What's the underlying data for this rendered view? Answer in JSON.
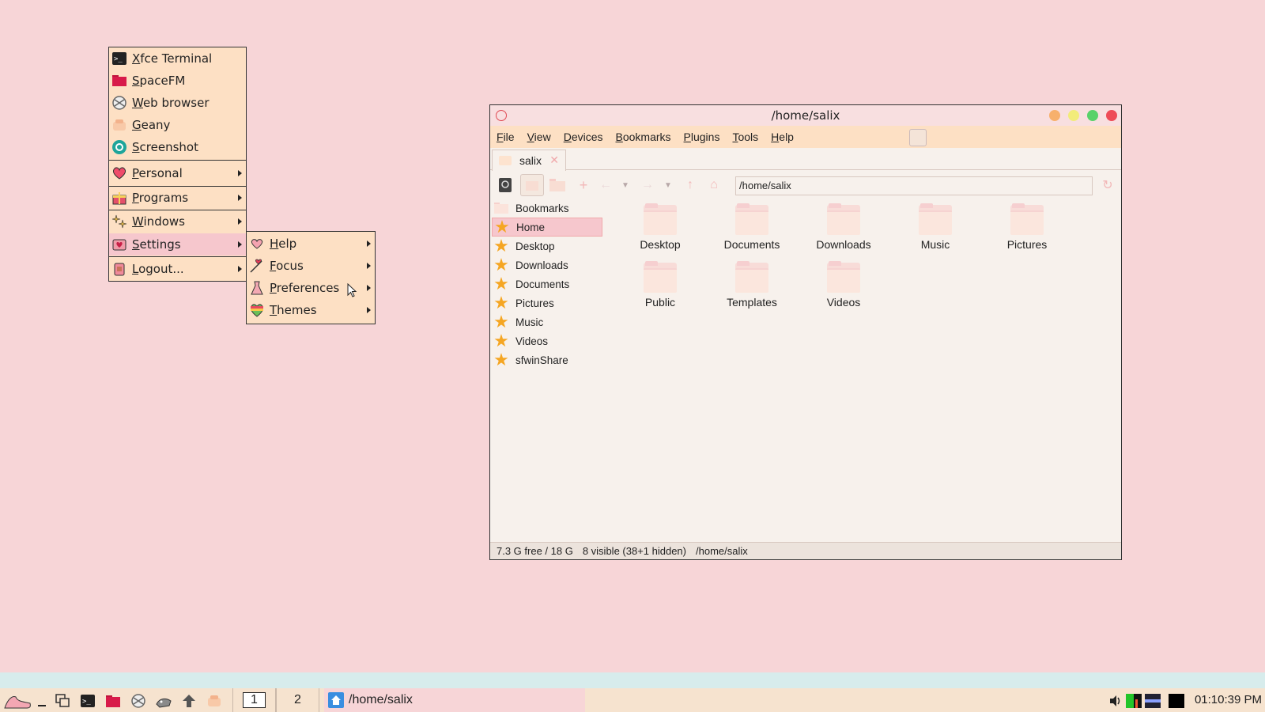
{
  "root_menu": {
    "items": [
      {
        "label": "Xfce Terminal",
        "icon": "terminal-icon"
      },
      {
        "label": "SpaceFM",
        "icon": "folder-red-icon"
      },
      {
        "label": "Web browser",
        "icon": "web-browser-icon"
      },
      {
        "label": "Geany",
        "icon": "geany-icon"
      },
      {
        "label": "Screenshot",
        "icon": "screenshot-icon"
      },
      {
        "label": "Personal",
        "icon": "heart-icon",
        "submenu": true
      },
      {
        "label": "Programs",
        "icon": "gift-icon",
        "submenu": true
      },
      {
        "label": "Windows",
        "icon": "sparkles-icon",
        "submenu": true
      },
      {
        "label": "Settings",
        "icon": "settings-icon",
        "submenu": true,
        "active": true
      },
      {
        "label": "Logout...",
        "icon": "logout-icon",
        "submenu": true
      }
    ]
  },
  "settings_submenu": {
    "items": [
      {
        "label": "Help",
        "icon": "help-heart-icon"
      },
      {
        "label": "Focus",
        "icon": "focus-arrow-icon"
      },
      {
        "label": "Preferences",
        "icon": "preferences-dress-icon"
      },
      {
        "label": "Themes",
        "icon": "themes-rainbow-icon"
      }
    ]
  },
  "window": {
    "title": "/home/salix",
    "menubar": [
      "File",
      "View",
      "Devices",
      "Bookmarks",
      "Plugins",
      "Tools",
      "Help"
    ],
    "tab_label": "salix",
    "path": "/home/salix",
    "sidebar": [
      {
        "label": "Bookmarks",
        "icon": "folder-icon"
      },
      {
        "label": "Home",
        "icon": "star-icon",
        "selected": true
      },
      {
        "label": "Desktop",
        "icon": "star-icon"
      },
      {
        "label": "Downloads",
        "icon": "star-icon"
      },
      {
        "label": "Documents",
        "icon": "star-icon"
      },
      {
        "label": "Pictures",
        "icon": "star-icon"
      },
      {
        "label": "Music",
        "icon": "star-icon"
      },
      {
        "label": "Videos",
        "icon": "star-icon"
      },
      {
        "label": "sfwinShare",
        "icon": "star-icon"
      }
    ],
    "folders": [
      "Desktop",
      "Documents",
      "Downloads",
      "Music",
      "Pictures",
      "Public",
      "Templates",
      "Videos"
    ],
    "status": {
      "free": "7.3 G free / 18 G",
      "visible": "8 visible (38+1 hidden)",
      "path": "/home/salix"
    }
  },
  "taskbar": {
    "desktops": [
      "1",
      "2"
    ],
    "task_label": "/home/salix",
    "clock": "01:10:39 PM"
  },
  "colors": {
    "desktop_bg": "#f7d5d7",
    "menu_bg": "#fde0c4",
    "accent_pink": "#f6c7cd",
    "close_red": "#ee4b57",
    "max_green": "#58d26a",
    "min_yellow": "#f2ec7a",
    "shade_orange": "#f7b06c"
  }
}
